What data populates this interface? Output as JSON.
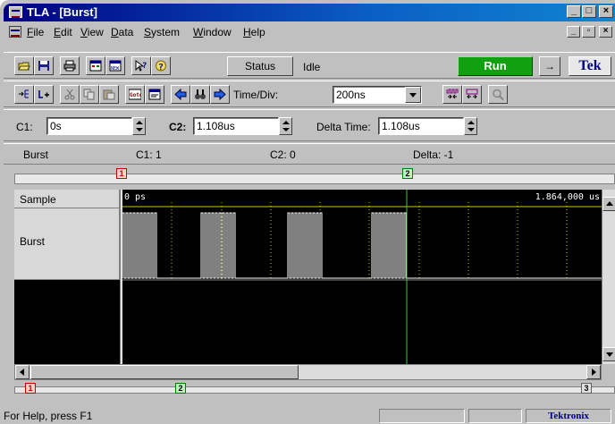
{
  "window": {
    "title": "TLA - [Burst]",
    "controls": {
      "minimize": "_",
      "maximize": "□",
      "close": "×"
    }
  },
  "menubar": {
    "items": [
      {
        "label": "File",
        "accel": "F"
      },
      {
        "label": "Edit",
        "accel": "E"
      },
      {
        "label": "View",
        "accel": "V"
      },
      {
        "label": "Data",
        "accel": "D"
      },
      {
        "label": "System",
        "accel": "S"
      },
      {
        "label": "Window",
        "accel": "W"
      },
      {
        "label": "Help",
        "accel": "H"
      }
    ],
    "doc_controls": {
      "minimize": "_",
      "restore": "▫",
      "close": "×"
    }
  },
  "toolbar1": {
    "buttons": [
      "open-icon",
      "save-icon",
      "print-icon",
      "system-window-icon",
      "new-window-icon",
      "context-help-icon",
      "help-icon"
    ],
    "status_label": "Status",
    "status_value": "Idle",
    "run_label": "Run",
    "run_arrow": "→",
    "brand": "Tek"
  },
  "toolbar2": {
    "buttons": [
      "add-waveform-icon",
      "add-channel-icon",
      "cut-icon",
      "copy-icon",
      "paste-icon",
      "goto-icon",
      "properties-icon",
      "search-back-icon",
      "find-icon",
      "search-forward-icon"
    ],
    "timediv_label": "Time/Div:",
    "timediv_value": "200ns",
    "zoom_buttons": [
      "zoom-in-icon",
      "zoom-out-icon",
      "magnify-icon"
    ]
  },
  "cursor_bar": {
    "c1_label": "C1:",
    "c1_value": "0s",
    "c2_label": "C2:",
    "c2_value": "1.108us",
    "delta_label": "Delta Time:",
    "delta_value": "1.108us"
  },
  "info_bar": {
    "name": "Burst",
    "c1": "C1: 1",
    "c2": "C2: 0",
    "delta": "Delta: -1"
  },
  "waveform": {
    "rows": [
      {
        "name": "Sample"
      },
      {
        "name": "Burst"
      }
    ],
    "time_start": "0 ps",
    "time_end": "1.864,000 us",
    "cursor_labels": {
      "c1": "1",
      "c2": "2",
      "c3": "3"
    },
    "bursts": [
      {
        "start": 0.0,
        "pulses": 10
      },
      {
        "start": 0.165,
        "pulses": 10
      },
      {
        "start": 0.345,
        "pulses": 10
      },
      {
        "start": 0.52,
        "pulses": 10
      }
    ],
    "colors": {
      "signal": "#ffffff",
      "grid": "#c8c800",
      "cursor1": "#ff3333",
      "cursor2": "#33cc33",
      "background": "#000000"
    }
  },
  "statusbar": {
    "help_text": "For Help, press F1",
    "brand": "Tektronix"
  }
}
